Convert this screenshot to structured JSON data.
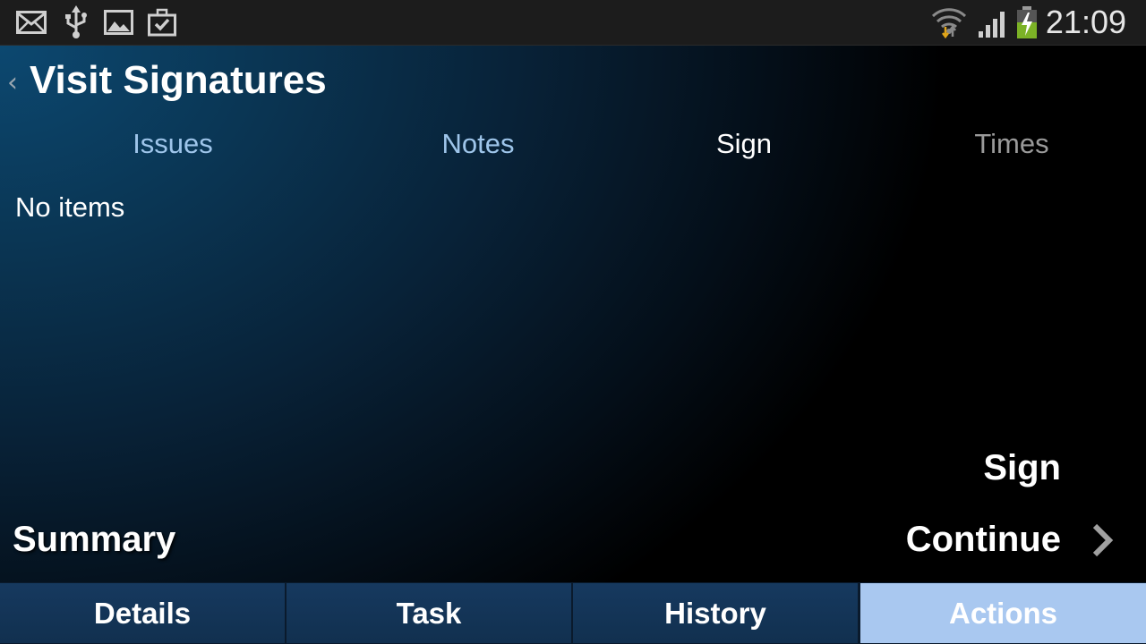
{
  "status_bar": {
    "time": "21:09",
    "icons": [
      "mail-icon",
      "usb-icon",
      "gallery-icon",
      "briefcase-check-icon",
      "wifi-icon",
      "signal-icon",
      "battery-charging-icon"
    ]
  },
  "header": {
    "title": "Visit Signatures"
  },
  "tabs": [
    {
      "label": "Issues"
    },
    {
      "label": "Notes"
    },
    {
      "label": "Sign",
      "selected": true
    },
    {
      "label": "Times"
    }
  ],
  "list": {
    "empty_text": "No items"
  },
  "actions": {
    "sign_label": "Sign",
    "summary_label": "Summary",
    "continue_label": "Continue"
  },
  "bottom_nav": [
    {
      "label": "Details"
    },
    {
      "label": "Task"
    },
    {
      "label": "History"
    },
    {
      "label": "Actions",
      "selected": true
    }
  ],
  "colors": {
    "tab_link": "#9ec5ea",
    "tab_disabled": "#9a9a9a",
    "nav_active": "#a9c8f0",
    "nav_bg": "#16395f"
  }
}
